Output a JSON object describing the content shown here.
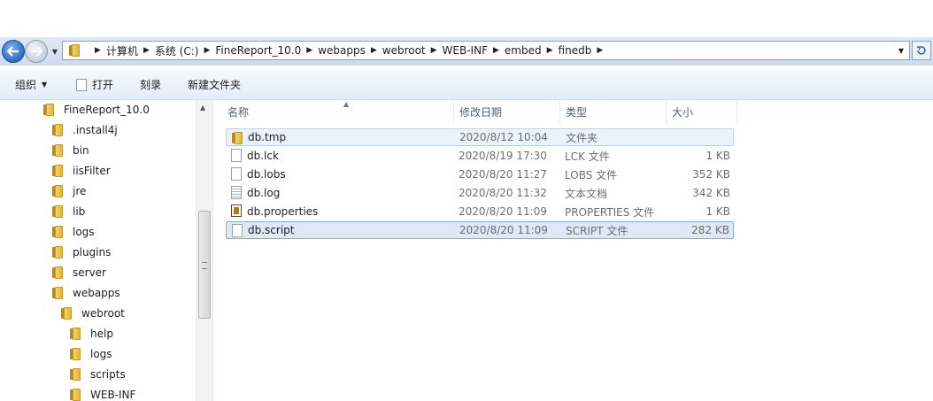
{
  "address": {
    "crumbs": [
      "计算机",
      "系统 (C:)",
      "FineReport_10.0",
      "webapps",
      "webroot",
      "WEB-INF",
      "embed",
      "finedb"
    ]
  },
  "toolbar": {
    "organize_label": "组织",
    "open_label": "打开",
    "burn_label": "刻录",
    "new_folder_label": "新建文件夹"
  },
  "tree": {
    "items": [
      {
        "label": "FineReport_10.0"
      },
      {
        "label": ".install4j"
      },
      {
        "label": "bin"
      },
      {
        "label": "iisFilter"
      },
      {
        "label": "jre"
      },
      {
        "label": "lib"
      },
      {
        "label": "logs"
      },
      {
        "label": "plugins"
      },
      {
        "label": "server"
      },
      {
        "label": "webapps"
      },
      {
        "label": "webroot"
      },
      {
        "label": "help"
      },
      {
        "label": "logs"
      },
      {
        "label": "scripts"
      },
      {
        "label": "WEB-INF"
      }
    ]
  },
  "columns": {
    "name": "名称",
    "date": "修改日期",
    "type": "类型",
    "size": "大小"
  },
  "files": [
    {
      "name": "db.tmp",
      "date": "2020/8/12 10:04",
      "type": "文件夹",
      "size": "",
      "icon": "folder-icon",
      "state": "hover"
    },
    {
      "name": "db.lck",
      "date": "2020/8/19 17:30",
      "type": "LCK 文件",
      "size": "1 KB",
      "icon": "file-icon",
      "state": ""
    },
    {
      "name": "db.lobs",
      "date": "2020/8/20 11:27",
      "type": "LOBS 文件",
      "size": "352 KB",
      "icon": "file-icon",
      "state": ""
    },
    {
      "name": "db.log",
      "date": "2020/8/20 11:32",
      "type": "文本文档",
      "size": "342 KB",
      "icon": "text-file-icon",
      "state": ""
    },
    {
      "name": "db.properties",
      "date": "2020/8/20 11:09",
      "type": "PROPERTIES 文件",
      "size": "1 KB",
      "icon": "properties-file-icon",
      "state": ""
    },
    {
      "name": "db.script",
      "date": "2020/8/20 11:09",
      "type": "SCRIPT 文件",
      "size": "282 KB",
      "icon": "file-icon",
      "state": "selected"
    }
  ],
  "colors": {
    "selection": "#dde9f7",
    "selection_border": "#84acdd",
    "folder": "#e6b62f"
  }
}
